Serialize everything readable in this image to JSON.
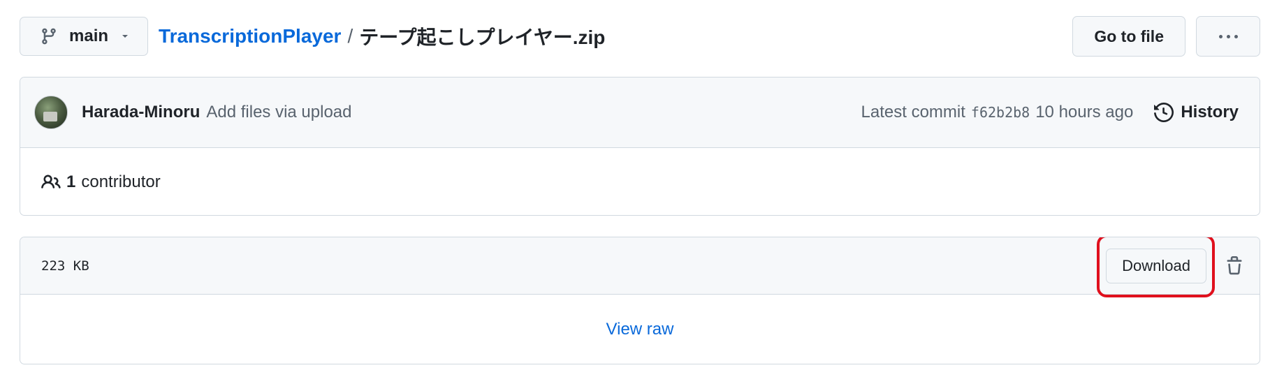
{
  "branch": {
    "name": "main",
    "icon": "git-branch-icon"
  },
  "breadcrumb": {
    "repo": "TranscriptionPlayer",
    "separator": "/",
    "file": "テープ起こしプレイヤー.zip"
  },
  "header_actions": {
    "go_to_file": "Go to file",
    "more_icon": "kebab-horizontal-icon"
  },
  "commit": {
    "author": "Harada-Minoru",
    "message": "Add files via upload",
    "latest_label": "Latest commit",
    "sha": "f62b2b8",
    "time": "10 hours ago",
    "history_label": "History"
  },
  "contributors": {
    "count": "1",
    "label": "contributor"
  },
  "file": {
    "size": "223 KB",
    "download_label": "Download",
    "view_raw_label": "View raw"
  },
  "colors": {
    "link": "#0969da",
    "highlight": "#e0101d",
    "muted": "#59636e",
    "border": "#d1d9e0",
    "panel": "#f6f8fa"
  }
}
